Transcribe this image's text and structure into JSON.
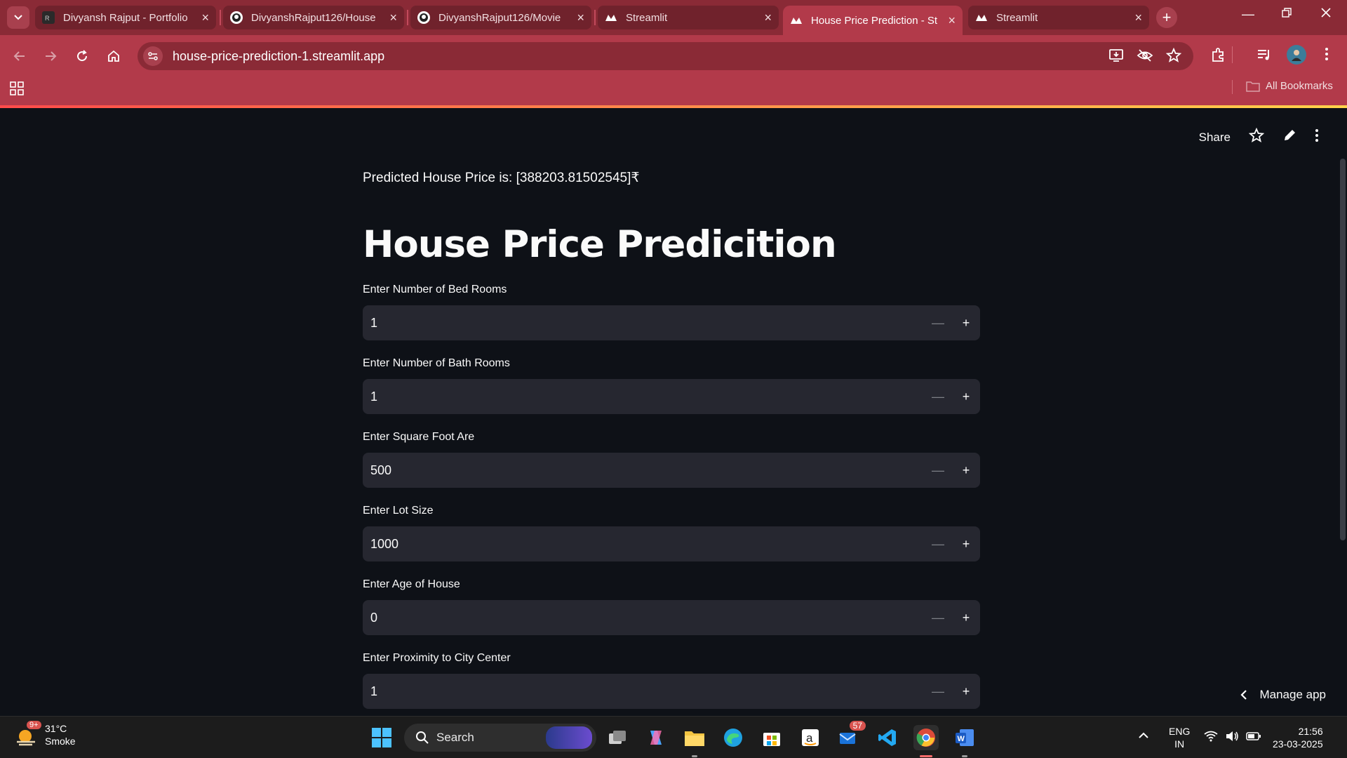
{
  "browser": {
    "tabs": [
      {
        "title": "Divyansh Rajput - Portfolio",
        "icon": "portfolio-icon"
      },
      {
        "title": "DivyanshRajput126/House",
        "icon": "github-icon"
      },
      {
        "title": "DivyanshRajput126/Movie",
        "icon": "github-icon"
      },
      {
        "title": "Streamlit",
        "icon": "streamlit-icon"
      },
      {
        "title": "House Price Prediction - St",
        "icon": "streamlit-icon"
      },
      {
        "title": "Streamlit",
        "icon": "streamlit-icon"
      }
    ],
    "active_tab_index": 4,
    "url": "house-price-prediction-1.streamlit.app",
    "bookmarks_label": "All Bookmarks",
    "theme_color": "#b23a4a"
  },
  "app": {
    "share_label": "Share",
    "prediction_text": "Predicted House Price is: [388203.81502545]₹",
    "title": "House Price Predicition",
    "fields": [
      {
        "label": "Enter Number of Bed Rooms",
        "value": "1"
      },
      {
        "label": "Enter Number of Bath Rooms",
        "value": "1"
      },
      {
        "label": "Enter Square Foot Are",
        "value": "500"
      },
      {
        "label": "Enter Lot Size",
        "value": "1000"
      },
      {
        "label": "Enter Age of House",
        "value": "0"
      },
      {
        "label": "Enter Proximity to City Center",
        "value": "1"
      }
    ],
    "manage_label": "Manage app"
  },
  "taskbar": {
    "weather_temp": "31°C",
    "weather_desc": "Smoke",
    "weather_badge": "9+",
    "search_label": "Search",
    "mail_badge": "57",
    "lang_line1": "ENG",
    "lang_line2": "IN",
    "time": "21:56",
    "date": "23-03-2025"
  }
}
